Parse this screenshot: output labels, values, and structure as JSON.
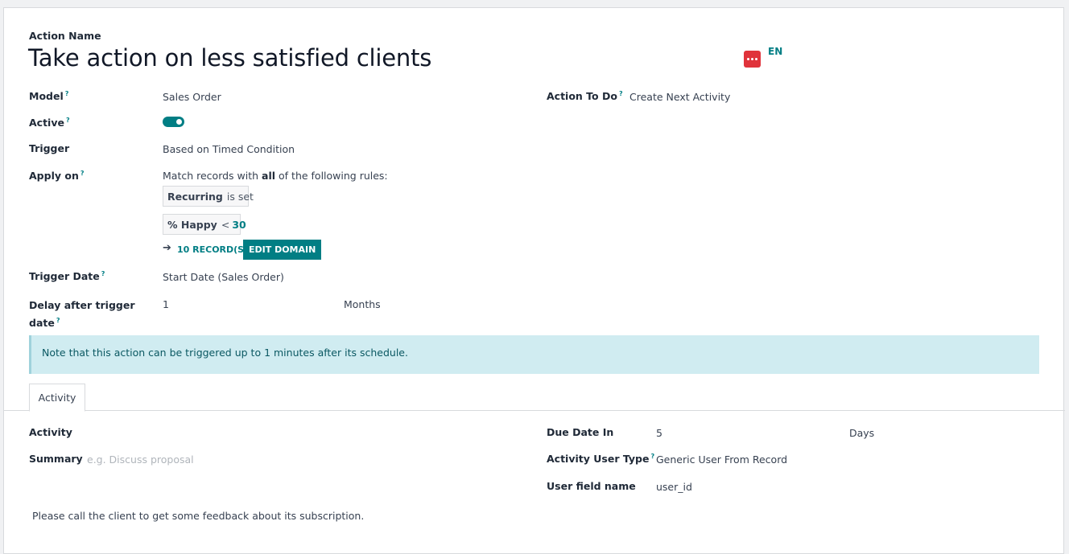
{
  "header": {
    "action_name_label": "Action Name",
    "title": "Take action on less satisfied clients",
    "lang_code": "EN"
  },
  "fields": {
    "model": {
      "label": "Model",
      "help": "?",
      "value": "Sales Order"
    },
    "active": {
      "label": "Active",
      "help": "?",
      "value": true
    },
    "trigger": {
      "label": "Trigger",
      "value": "Based on Timed Condition"
    },
    "apply_on": {
      "label": "Apply on",
      "help": "?",
      "prefix": "Match records with ",
      "quantifier": "all",
      "suffix": " of the following rules:",
      "rules": [
        {
          "field": "Recurring",
          "operator": "is set",
          "value": ""
        },
        {
          "field": "% Happy",
          "operator": "<",
          "value": "30"
        }
      ],
      "records_link": "10 RECORD(S)",
      "edit_domain_button": "EDIT DOMAIN"
    },
    "trigger_date": {
      "label": "Trigger Date",
      "help": "?",
      "value": "Start Date (Sales Order)"
    },
    "delay": {
      "label_line1": "Delay after trigger",
      "label_line2": "date",
      "help": "?",
      "value": "1",
      "unit": "Months"
    },
    "action_to_do": {
      "label": "Action To Do",
      "help": "?",
      "value": "Create Next Activity"
    }
  },
  "alert": {
    "text": "Note that this action can be triggered up to 1 minutes after its schedule."
  },
  "tabs": [
    {
      "label": "Activity"
    }
  ],
  "activity": {
    "activity_label": "Activity",
    "summary_label": "Summary",
    "summary_placeholder": "e.g. Discuss proposal",
    "due_date_label": "Due Date In",
    "due_date_value": "5",
    "due_date_unit": "Days",
    "user_type_label": "Activity User Type",
    "user_type_help": "?",
    "user_type_value": "Generic User From Record",
    "user_field_label": "User field name",
    "user_field_value": "user_id",
    "note": "Please call the client to get some feedback about its subscription."
  },
  "colors": {
    "accent": "#017e84",
    "alert_bg": "#d0ecf1",
    "lang_icon": "#e0333b"
  }
}
